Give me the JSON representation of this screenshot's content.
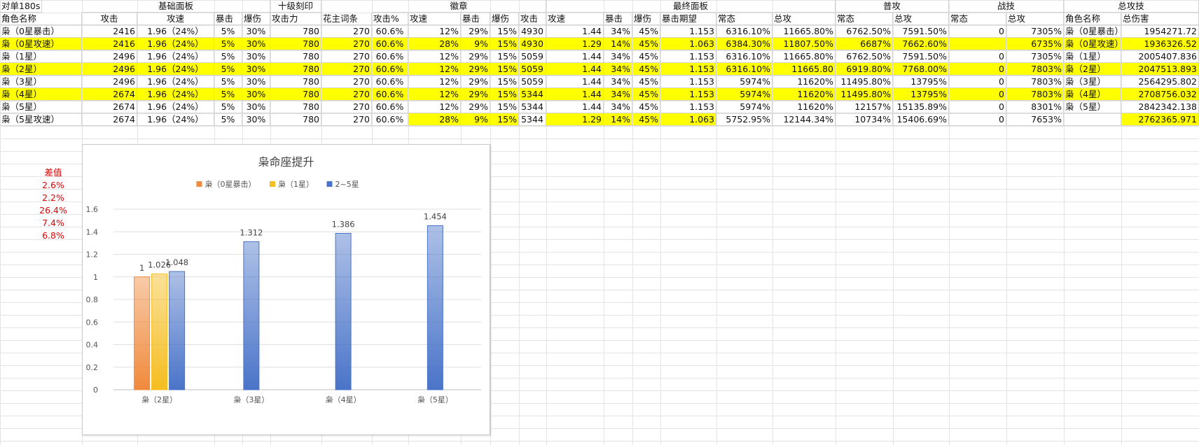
{
  "sheet": {
    "group_headers": [
      {
        "label": "基础面板",
        "col": 1,
        "span": 4
      },
      {
        "label": "十级刻印",
        "col": 5,
        "span": 1
      },
      {
        "label": "徽章",
        "col": 7,
        "span": 5
      },
      {
        "label": "最终面板",
        "col": 12,
        "span": 6
      },
      {
        "label": "普攻",
        "col": 18,
        "span": 2
      },
      {
        "label": "战技",
        "col": 20,
        "span": 2
      },
      {
        "label": "总攻技",
        "col": 22,
        "span": 2
      },
      {
        "label": "对单180s",
        "col": 25,
        "span": 1
      }
    ],
    "sub_headers": [
      "角色名称",
      "攻击",
      "攻速",
      "暴击",
      "爆伤",
      "攻击力",
      "花主词条",
      "攻击%",
      "攻速",
      "暴击",
      "爆伤",
      "攻击",
      "攻速",
      "暴击",
      "爆伤",
      "暴击期望",
      "常态",
      "总攻",
      "常态",
      "总攻",
      "常态",
      "总攻",
      "角色名称",
      "总伤害"
    ],
    "rows": [
      {
        "hl": [],
        "cells": [
          "枭（0星暴击）",
          "2416",
          "1.96（24%）",
          "5%",
          "30%",
          "780",
          "270",
          "60.6%",
          "12%",
          "29%",
          "15%",
          "4930",
          "1.44",
          "34%",
          "45%",
          "1.153",
          "6316.10%",
          "11665.80%",
          "6762.50%",
          "7591.50%",
          "0",
          "7305%",
          "枭（0星暴击）",
          "1954271.72"
        ]
      },
      {
        "hl": [
          0,
          1,
          2,
          3,
          4,
          5,
          6,
          7,
          8,
          9,
          10,
          11,
          12,
          13,
          14,
          15,
          16,
          17,
          18,
          19,
          20,
          21,
          22,
          23
        ],
        "cells": [
          "枭（0星攻速）",
          "2416",
          "1.96（24%）",
          "5%",
          "30%",
          "780",
          "270",
          "60.6%",
          "28%",
          "9%",
          "15%",
          "4930",
          "1.29",
          "14%",
          "45%",
          "1.063",
          "6384.30%",
          "11807.50%",
          "6687%",
          "7662.60%",
          "",
          "6735%",
          "枭（0星攻速）",
          "1936326.52"
        ]
      },
      {
        "hl": [],
        "cells": [
          "枭（1星）",
          "2496",
          "1.96（24%）",
          "5%",
          "30%",
          "780",
          "270",
          "60.6%",
          "12%",
          "29%",
          "15%",
          "5059",
          "1.44",
          "34%",
          "45%",
          "1.153",
          "6316.10%",
          "11665.80%",
          "6762.50%",
          "7591.50%",
          "0",
          "7305%",
          "枭（1星）",
          "2005407.836"
        ]
      },
      {
        "hl": [
          0,
          1,
          2,
          3,
          4,
          5,
          6,
          7,
          8,
          9,
          10,
          11,
          12,
          13,
          14,
          15,
          16,
          17,
          18,
          19,
          20,
          21,
          22,
          23
        ],
        "cells": [
          "枭（2星）",
          "2496",
          "1.96（24%）",
          "5%",
          "30%",
          "780",
          "270",
          "60.6%",
          "12%",
          "29%",
          "15%",
          "5059",
          "1.44",
          "34%",
          "45%",
          "1.153",
          "6316.10%",
          "11665.80",
          "6919.80%",
          "7768.00%",
          "0",
          "7803%",
          "枭（2星）",
          "2047513.893"
        ]
      },
      {
        "hl": [],
        "cells": [
          "枭（3星）",
          "2496",
          "1.96（24%）",
          "5%",
          "30%",
          "780",
          "270",
          "60.6%",
          "12%",
          "29%",
          "15%",
          "5059",
          "1.44",
          "34%",
          "45%",
          "1.153",
          "5974%",
          "11620%",
          "11495.80%",
          "13795%",
          "0",
          "7803%",
          "枭（3星）",
          "2564295.802"
        ]
      },
      {
        "hl": [
          0,
          1,
          2,
          3,
          4,
          5,
          6,
          7,
          8,
          9,
          10,
          11,
          12,
          13,
          14,
          15,
          16,
          17,
          18,
          19,
          20,
          21,
          22,
          23
        ],
        "cells": [
          "枭（4星）",
          "2674",
          "1.96（24%）",
          "5%",
          "30%",
          "780",
          "270",
          "60.6%",
          "12%",
          "29%",
          "15%",
          "5344",
          "1.44",
          "34%",
          "45%",
          "1.153",
          "5974%",
          "11620%",
          "11495.80%",
          "13795%",
          "0",
          "7803%",
          "枭（4星）",
          "2708756.032"
        ]
      },
      {
        "hl": [],
        "cells": [
          "枭（5星）",
          "2674",
          "1.96（24%）",
          "5%",
          "30%",
          "780",
          "270",
          "60.6%",
          "12%",
          "29%",
          "15%",
          "5344",
          "1.44",
          "34%",
          "45%",
          "1.153",
          "5974%",
          "11620%",
          "12157%",
          "15135.89%",
          "0",
          "8301%",
          "枭（5星）",
          "2842342.138"
        ]
      },
      {
        "hl": [
          8,
          9,
          10,
          12,
          13,
          14,
          15,
          23
        ],
        "cells": [
          "枭（5星攻速）",
          "2674",
          "1.96（24%）",
          "5%",
          "30%",
          "780",
          "270",
          "60.6%",
          "28%",
          "9%",
          "15%",
          "5344",
          "1.29",
          "14%",
          "45%",
          "1.063",
          "5752.95%",
          "12144.34%",
          "10734%",
          "15406.69%",
          "0",
          "7653%",
          "",
          "2762365.971"
        ]
      }
    ]
  },
  "diff": {
    "header": "差值",
    "values": [
      "2.6%",
      "2.2%",
      "26.4%",
      "7.4%",
      "6.8%"
    ]
  },
  "chart_data": {
    "type": "bar",
    "title": "枭命座提升",
    "categories": [
      "枭（2星）",
      "枭（3星）",
      "枭（4星）",
      "枭（5星）"
    ],
    "series": [
      {
        "name": "枭（0星暴击）",
        "values": [
          1,
          null,
          null,
          null
        ],
        "color": "#f08a3c"
      },
      {
        "name": "枭（1星）",
        "values": [
          1.026,
          null,
          null,
          null
        ],
        "color": "#f5bd1f"
      },
      {
        "name": "2~5星",
        "values": [
          1.048,
          1.312,
          1.386,
          1.454
        ],
        "color": "#4a74c9"
      }
    ],
    "ylim": [
      0,
      1.6
    ],
    "yticks": [
      0,
      0.2,
      0.4,
      0.6,
      0.8,
      1,
      1.2,
      1.4,
      1.6
    ],
    "grid": true,
    "legend": "top-center"
  }
}
